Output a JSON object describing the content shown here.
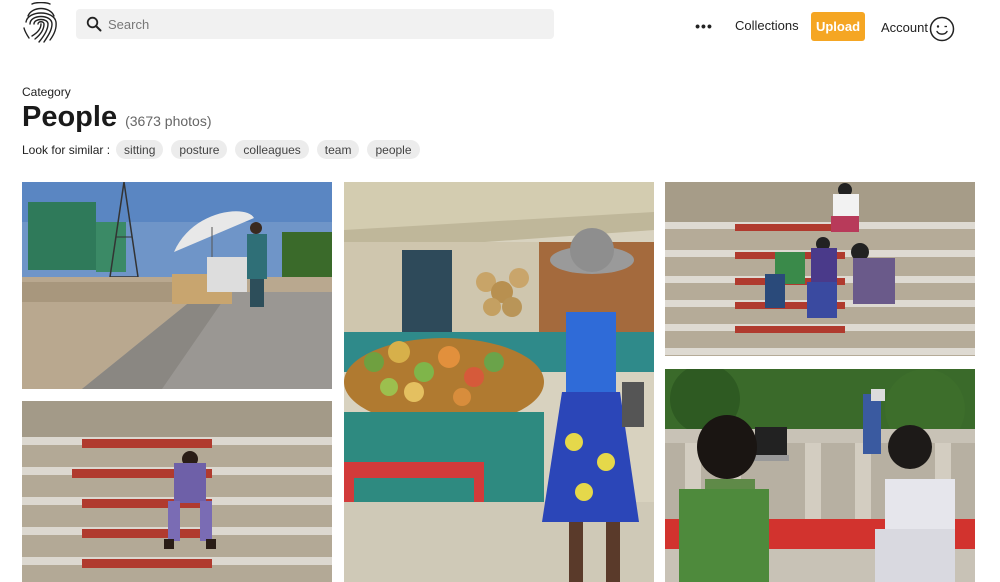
{
  "header": {
    "search_placeholder": "Search",
    "more_label": "•••",
    "collections_label": "Collections",
    "upload_label": "Upload",
    "account_label": "Account"
  },
  "category": {
    "label": "Category",
    "title": "People",
    "count": "(3673 photos)",
    "similar_label": "Look for similar :",
    "tags": [
      "sitting",
      "posture",
      "colleagues",
      "team",
      "people"
    ]
  },
  "colors": {
    "upload_accent": "#f5a623",
    "search_bg": "#f1f1f1",
    "tag_bg": "#ececec"
  }
}
